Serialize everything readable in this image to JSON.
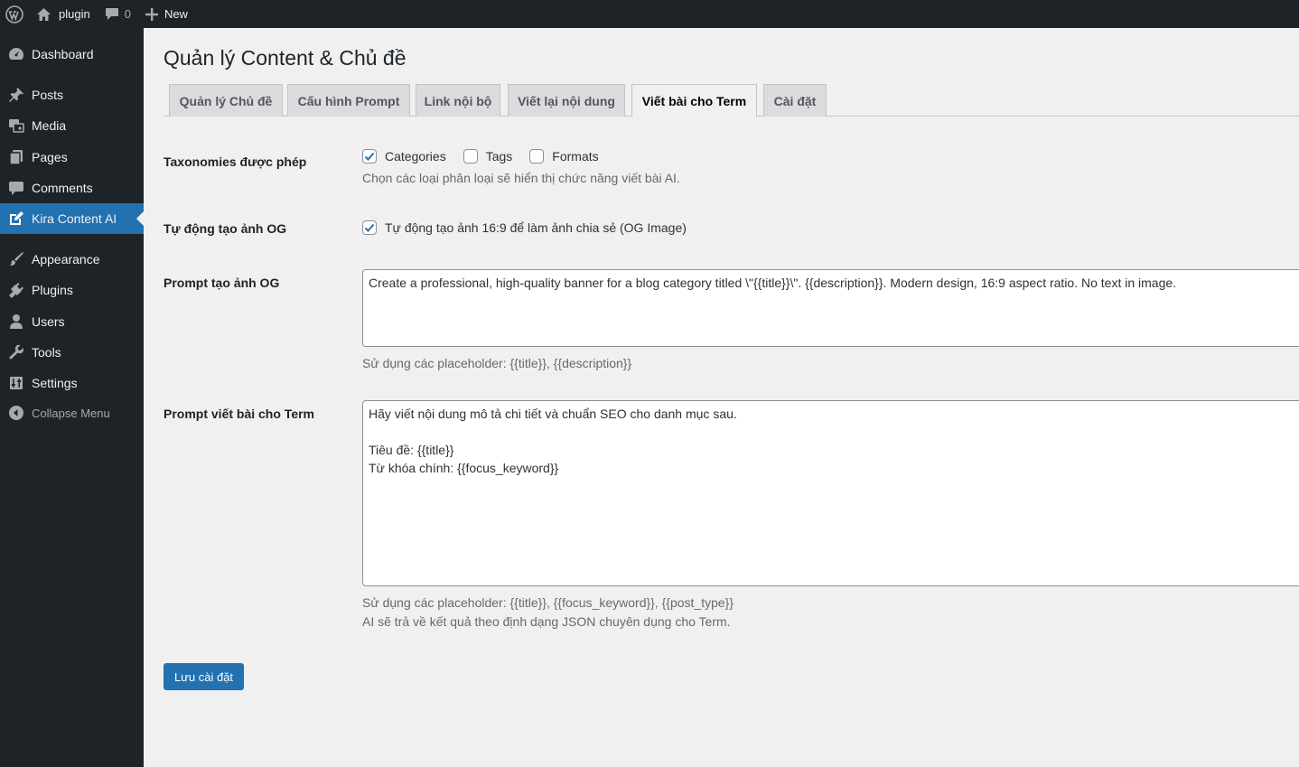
{
  "adminbar": {
    "site_name": "plugin",
    "comments_count": "0",
    "new_label": "New"
  },
  "sidebar": {
    "items": [
      {
        "label": "Dashboard",
        "icon": "dashboard-icon"
      },
      {
        "label": "Posts",
        "icon": "pin-icon"
      },
      {
        "label": "Media",
        "icon": "media-icon"
      },
      {
        "label": "Pages",
        "icon": "pages-icon"
      },
      {
        "label": "Comments",
        "icon": "comment-icon"
      },
      {
        "label": "Kira Content AI",
        "icon": "edit-icon",
        "current": true
      },
      {
        "label": "Appearance",
        "icon": "brush-icon"
      },
      {
        "label": "Plugins",
        "icon": "plugin-icon"
      },
      {
        "label": "Users",
        "icon": "user-icon"
      },
      {
        "label": "Tools",
        "icon": "wrench-icon"
      },
      {
        "label": "Settings",
        "icon": "settings-icon"
      }
    ],
    "collapse_label": "Collapse Menu"
  },
  "page": {
    "title": "Quản lý Content & Chủ đề"
  },
  "tabs": [
    {
      "label": "Quản lý Chủ đề"
    },
    {
      "label": "Cấu hình Prompt"
    },
    {
      "label": "Link nội bộ"
    },
    {
      "label": "Viết lại nội dung"
    },
    {
      "label": "Viết bài cho Term",
      "active": true
    },
    {
      "label": "Cài đặt"
    }
  ],
  "form": {
    "taxonomies": {
      "label": "Taxonomies được phép",
      "options": [
        {
          "label": "Categories",
          "checked": true
        },
        {
          "label": "Tags",
          "checked": false
        },
        {
          "label": "Formats",
          "checked": false
        }
      ],
      "description": "Chọn các loại phân loại sẽ hiển thị chức năng viết bài AI."
    },
    "og_auto": {
      "label": "Tự động tạo ảnh OG",
      "checkbox_label": "Tự động tạo ảnh 16:9 để làm ảnh chia sẻ (OG Image)",
      "checked": true
    },
    "og_prompt": {
      "label": "Prompt tạo ảnh OG",
      "value": "Create a professional, high-quality banner for a blog category titled \\\"{{title}}\\\". {{description}}. Modern design, 16:9 aspect ratio. No text in image.",
      "description": "Sử dụng các placeholder: {{title}}, {{description}}"
    },
    "term_prompt": {
      "label": "Prompt viết bài cho Term",
      "value": "Hãy viết nội dung mô tả chi tiết và chuẩn SEO cho danh mục sau.\n\nTiêu đề: {{title}}\nTừ khóa chính: {{focus_keyword}}",
      "description_1": "Sử dụng các placeholder: {{title}}, {{focus_keyword}}, {{post_type}}",
      "description_2": "AI sẽ trả về kết quả theo định dạng JSON chuyên dụng cho Term."
    },
    "save_label": "Lưu cài đặt"
  },
  "colors": {
    "admin_dark": "#1d2327",
    "accent": "#2271b1",
    "background": "#f0f0f1"
  }
}
